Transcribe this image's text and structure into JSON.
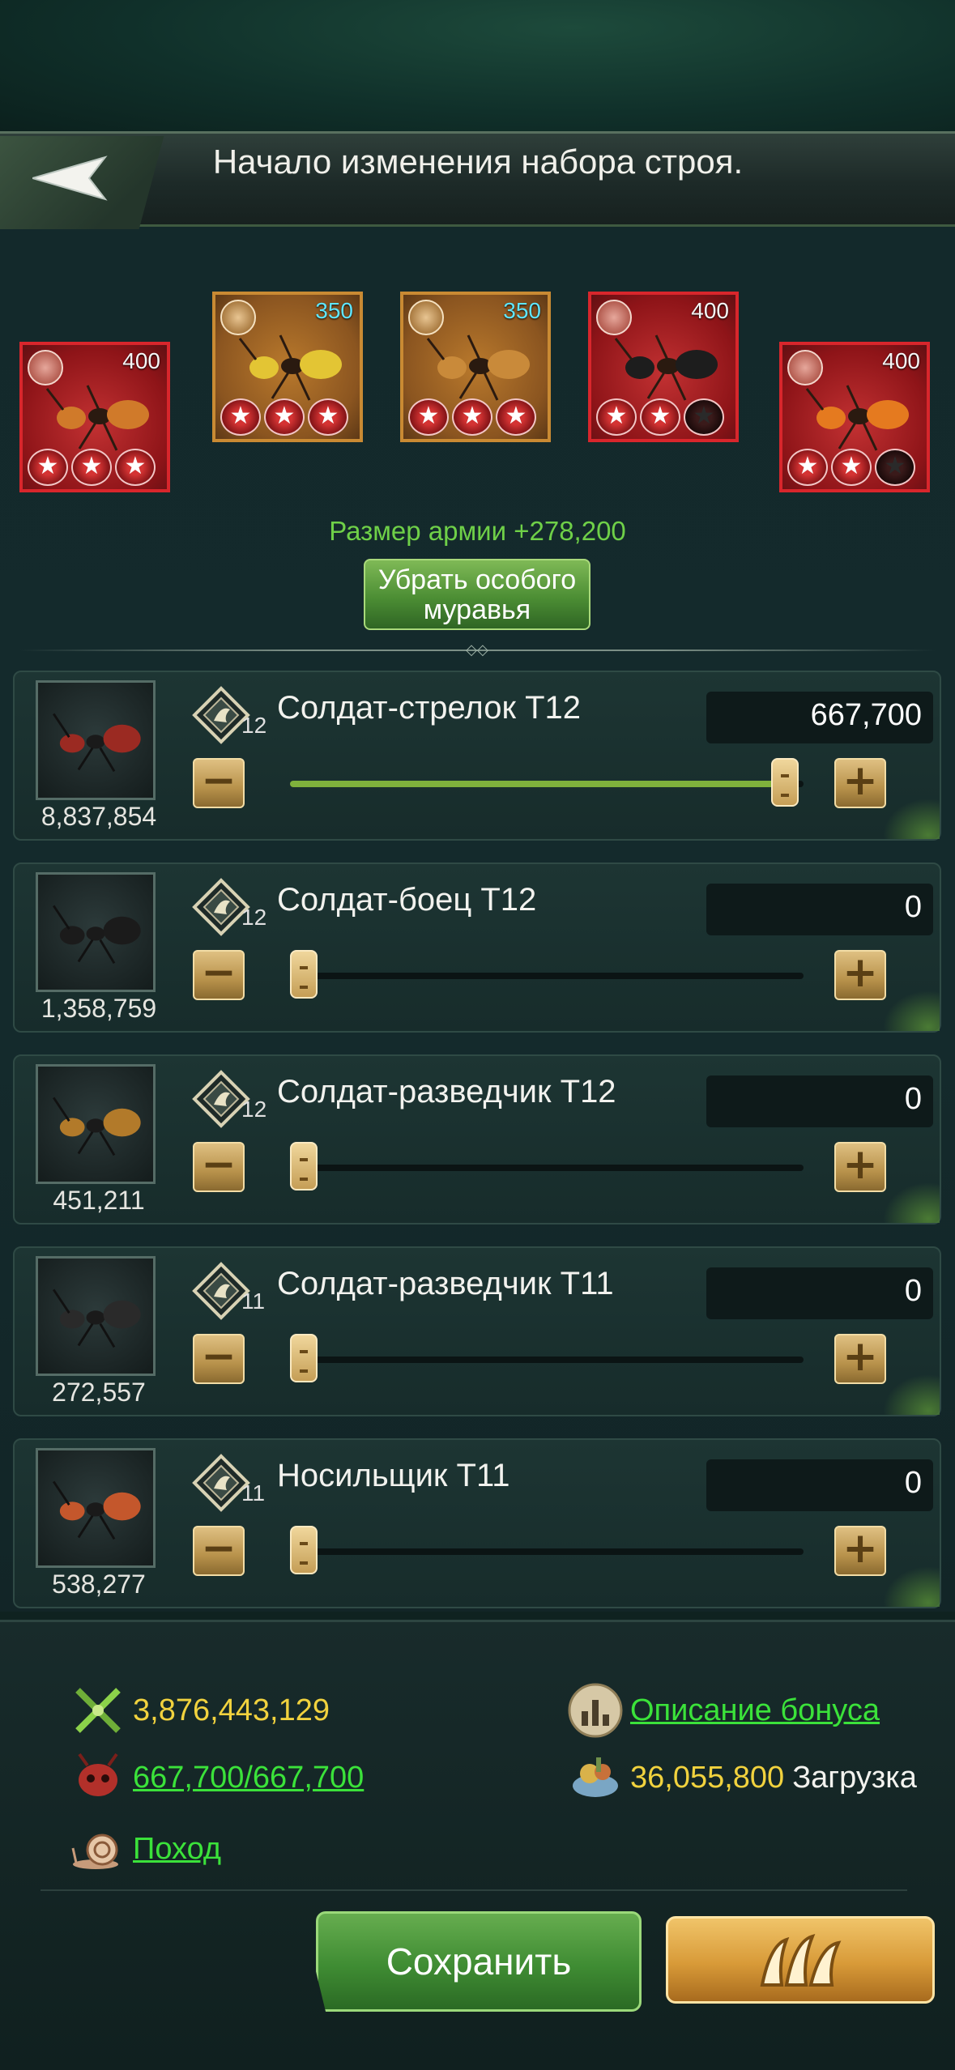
{
  "header": {
    "title": "Начало изменения набора строя."
  },
  "special_ants": [
    {
      "power": "400",
      "stars": 3,
      "max_stars": 3,
      "frame": "red"
    },
    {
      "power": "350",
      "stars": 3,
      "max_stars": 3,
      "frame": "gold"
    },
    {
      "power": "350",
      "stars": 3,
      "max_stars": 3,
      "frame": "gold"
    },
    {
      "power": "400",
      "stars": 2,
      "max_stars": 3,
      "frame": "red"
    },
    {
      "power": "400",
      "stars": 2,
      "max_stars": 3,
      "frame": "red"
    }
  ],
  "army": {
    "size_text": "Размер армии +278,200",
    "remove_button": "Убрать особого муравья"
  },
  "troops": [
    {
      "name": "Солдат-стрелок T12",
      "tier": "12",
      "available": "8,837,854",
      "value": "667,700",
      "fill": 1.0,
      "icon": "shooter-icon"
    },
    {
      "name": "Солдат-боец T12",
      "tier": "12",
      "available": "1,358,759",
      "value": "0",
      "fill": 0.0,
      "icon": "shield-icon"
    },
    {
      "name": "Солдат-разведчик T12",
      "tier": "12",
      "available": "451,211",
      "value": "0",
      "fill": 0.0,
      "icon": "boot-icon"
    },
    {
      "name": "Солдат-разведчик T11",
      "tier": "11",
      "available": "272,557",
      "value": "0",
      "fill": 0.0,
      "icon": "boot-icon"
    },
    {
      "name": "Носильщик T11",
      "tier": "11",
      "available": "538,277",
      "value": "0",
      "fill": 0.0,
      "icon": "carrier-icon"
    }
  ],
  "bottom": {
    "power": "3,876,443,129",
    "bonus_link": "Описание бонуса",
    "troops_count": "667,700/667,700",
    "load_value": "36,055,800",
    "load_label": "Загрузка",
    "march_link": "Поход",
    "save_button": "Сохранить"
  },
  "colors": {
    "accent_green": "#6fd048",
    "link_green": "#3be23a",
    "value_yellow": "#f1d23e"
  }
}
